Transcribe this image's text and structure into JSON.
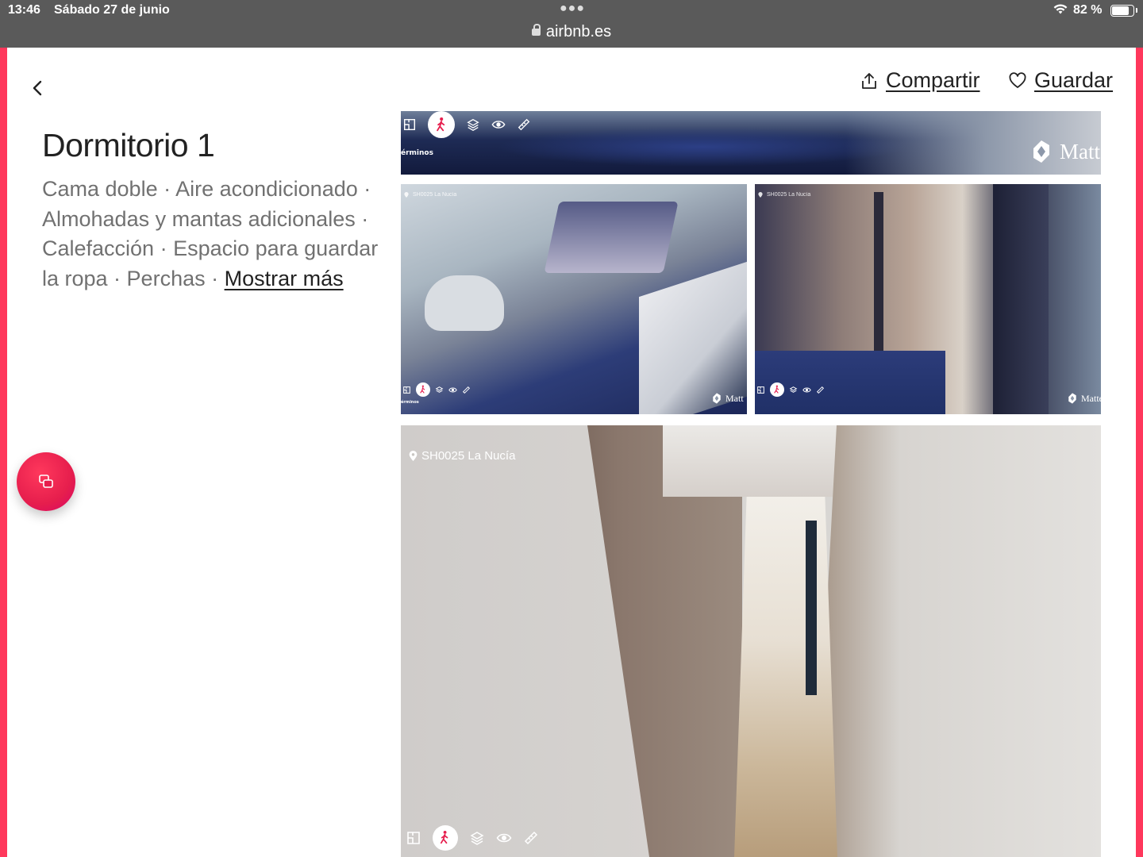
{
  "status_bar": {
    "time": "13:46",
    "date": "Sábado 27 de junio",
    "url": "airbnb.es",
    "battery_text": "82 %",
    "battery_level": 0.82
  },
  "header": {
    "back_icon": "chevron-left-icon",
    "share_label": "Compartir",
    "save_label": "Guardar"
  },
  "room": {
    "title": "Dormitorio 1",
    "amenities_text": "Cama doble · Aire acondicionado · Almohadas y mantas adicionales · Calefacción · Espacio para guardar la ropa · Perchas · ",
    "show_more": "Mostrar más"
  },
  "photos": [
    {
      "terms": "érminos",
      "brand": "Matt",
      "location": ""
    },
    {
      "terms": "érminos",
      "brand": "Matt",
      "location": "SH0025 La Nucía"
    },
    {
      "terms": "",
      "brand": "Matte",
      "location": "SH0025 La Nucía"
    },
    {
      "terms": "",
      "brand": "",
      "location": "SH0025 La Nucía"
    }
  ],
  "colors": {
    "accent": "#ff385c",
    "text_primary": "#222222",
    "text_secondary": "#717171",
    "status_bar": "#5a5a5a"
  }
}
